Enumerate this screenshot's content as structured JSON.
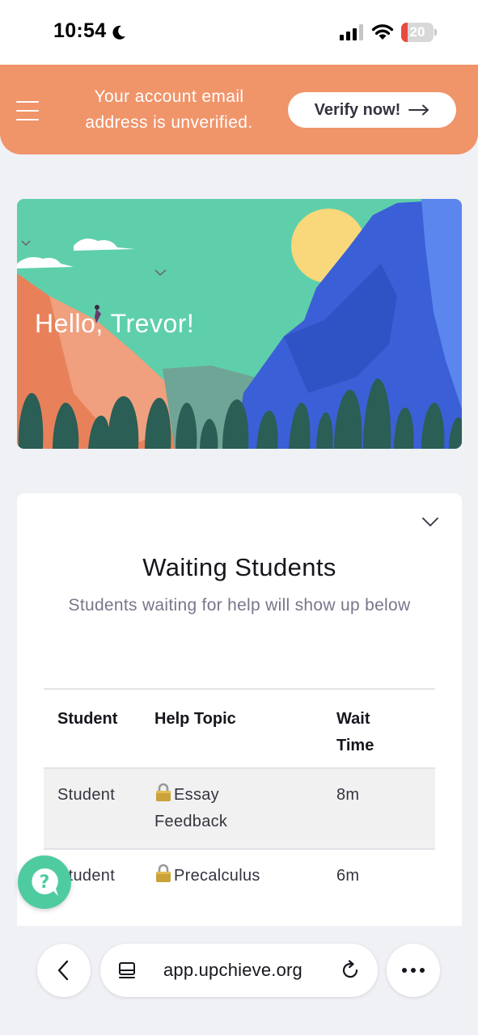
{
  "status_bar": {
    "time": "10:54",
    "battery": "20",
    "battery_level": 0.2
  },
  "banner": {
    "message": "Your account email address is unverified.",
    "verify_label": "Verify now!"
  },
  "hero": {
    "greeting": "Hello, Trevor!"
  },
  "waiting": {
    "title": "Waiting Students",
    "subtitle": "Students waiting for help will show up below",
    "columns": [
      "Student",
      "Help Topic",
      "Wait Time"
    ],
    "rows": [
      {
        "student": "Student",
        "topic": "Essay Feedback",
        "wait": "8m"
      },
      {
        "student": "Student",
        "topic": "Precalculus",
        "wait": "6m"
      }
    ]
  },
  "help_button": {
    "glyph": "?"
  },
  "browser": {
    "url": "app.upchieve.org"
  },
  "colors": {
    "banner": "#f0946a",
    "accent": "#4fcba0",
    "hero_sky": "#5fcfab"
  }
}
